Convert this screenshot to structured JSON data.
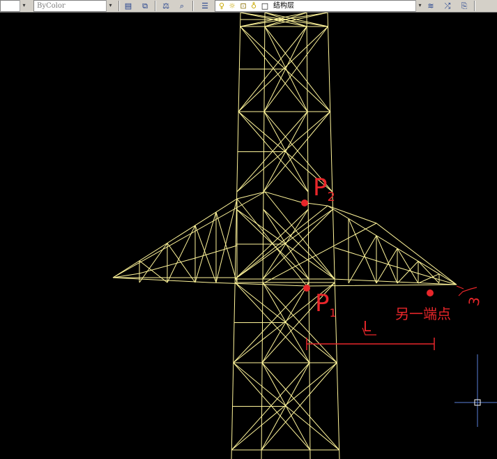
{
  "toolbar": {
    "linetype_value": "ByColor",
    "current_layer": "结构层",
    "icons": [
      "color-swatch-icon",
      "match-properties-icon",
      "scale-icon",
      "zoom-icon",
      "layer-properties-icon",
      "lightbulb-icon",
      "sun-icon",
      "lock-icon",
      "color-square-icon",
      "layer-previous-icon",
      "layer-states-icon",
      "layer-manager-icon"
    ]
  },
  "annotations": {
    "p2_label": "P",
    "p2_sub": "2",
    "p1_label": "P",
    "p1_sub": "1",
    "l_label": "L",
    "endpoint_label": "另一端点",
    "mark_3": "3"
  },
  "colors": {
    "background": "#000000",
    "wireframe": "#fff59a",
    "annotation": "#e8262a",
    "crosshair": "#5a7fd8"
  }
}
